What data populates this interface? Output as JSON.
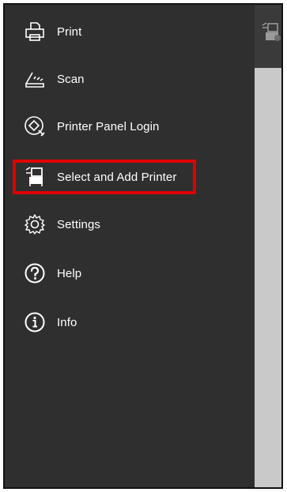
{
  "menu": {
    "items": [
      {
        "label": "Print",
        "icon": "print-icon"
      },
      {
        "label": "Scan",
        "icon": "scan-icon"
      },
      {
        "label": "Printer Panel Login",
        "icon": "printer-panel-login-icon"
      },
      {
        "label": "Select and Add Printer",
        "icon": "select-add-printer-icon",
        "highlighted": true
      },
      {
        "label": "Settings",
        "icon": "gear-icon"
      },
      {
        "label": "Help",
        "icon": "help-icon"
      },
      {
        "label": "Info",
        "icon": "info-icon"
      }
    ]
  },
  "colors": {
    "drawer_background": "#2f2f2f",
    "main_background": "#c9c9c9",
    "header_background": "#3a3a3a",
    "highlight": "#e00000",
    "text": "#ffffff"
  }
}
